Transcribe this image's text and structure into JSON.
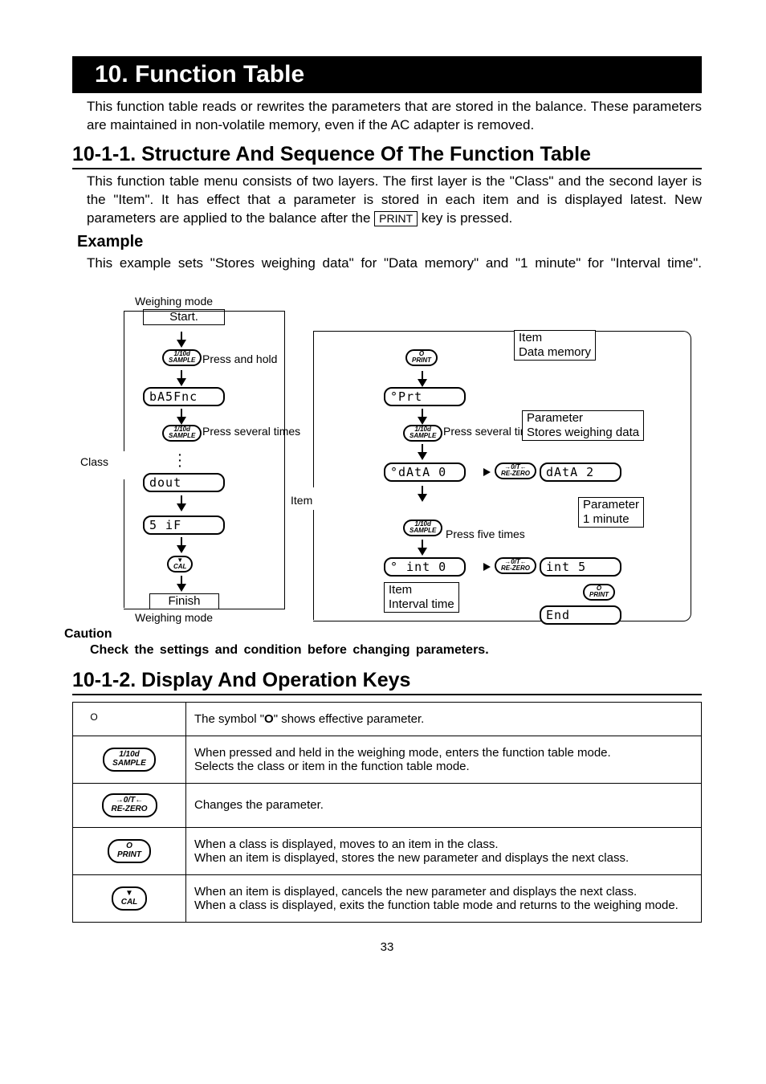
{
  "title": "10. Function Table",
  "intro": "This function table reads or rewrites the parameters that are stored in the balance. These parameters are maintained in non-volatile memory, even if the AC adapter is removed.",
  "section1": {
    "heading": "10-1-1.   Structure And Sequence Of The Function Table",
    "body_parts": {
      "p1a": "This function table menu consists of two layers. The first layer is the \"Class\" and the second layer is the \"Item\". It has effect that a parameter is stored in each item and is displayed latest. New parameters are applied to the balance after the ",
      "p1_key": "PRINT",
      "p1b": " key is pressed."
    },
    "example_hd": "Example",
    "example_txt": "This example sets \"Stores weighing data\" for \"Data memory\" and \"1 minute\" for \"Interval time\"."
  },
  "diagram": {
    "weighing_mode": "Weighing mode",
    "start": "Start.",
    "finish": "Finish",
    "class_label": "Class",
    "item_label": "Item",
    "press_hold": "Press and hold",
    "press_several": "Press several times",
    "press_five": "Press five times",
    "item_data_memory": "Item\nData memory",
    "param_stores": "Parameter\nStores weighing data",
    "param_1min": "Parameter\n1 minute",
    "item_interval": "Item\nInterval time",
    "lcd_basfnc": "bA5Fnc",
    "lcd_dout": "dout",
    "lcd_sif": "5 iF",
    "lcd_prt": "°Prt",
    "lcd_data0": "°dAtA  0",
    "lcd_data2": "dAtA  2",
    "lcd_int0": "° int  0",
    "lcd_int5": "int   5",
    "lcd_end": "End",
    "btn_sample": "1/10d\nSAMPLE",
    "btn_print": "O\nPRINT",
    "btn_cal": "▼\nCAL",
    "btn_rezero": "→0/T←\nRE-ZERO"
  },
  "caution": {
    "hd": "Caution",
    "tx": "Check the settings and condition before changing parameters."
  },
  "section2": {
    "heading": "10-1-2.   Display And Operation Keys"
  },
  "table": {
    "r1": {
      "sym": "O",
      "txt": "The symbol \"O\" shows effective parameter."
    },
    "r2": {
      "btn": "1/10d\nSAMPLE",
      "txt": "When pressed and held in the weighing mode, enters the function table mode.\nSelects the class or item in the function table mode."
    },
    "r3": {
      "btn": "→0/T←\nRE-ZERO",
      "txt": "Changes the parameter."
    },
    "r4": {
      "btn": "O\nPRINT",
      "txt": "When a class is displayed, moves to an item in the class.\nWhen an item is displayed, stores the new parameter and displays the next class."
    },
    "r5": {
      "btn": "▼\nCAL",
      "txt": "When an item is displayed, cancels the new parameter and displays the next class.\nWhen a class is displayed, exits the function table mode and returns to the weighing mode."
    }
  },
  "page_num": "33"
}
